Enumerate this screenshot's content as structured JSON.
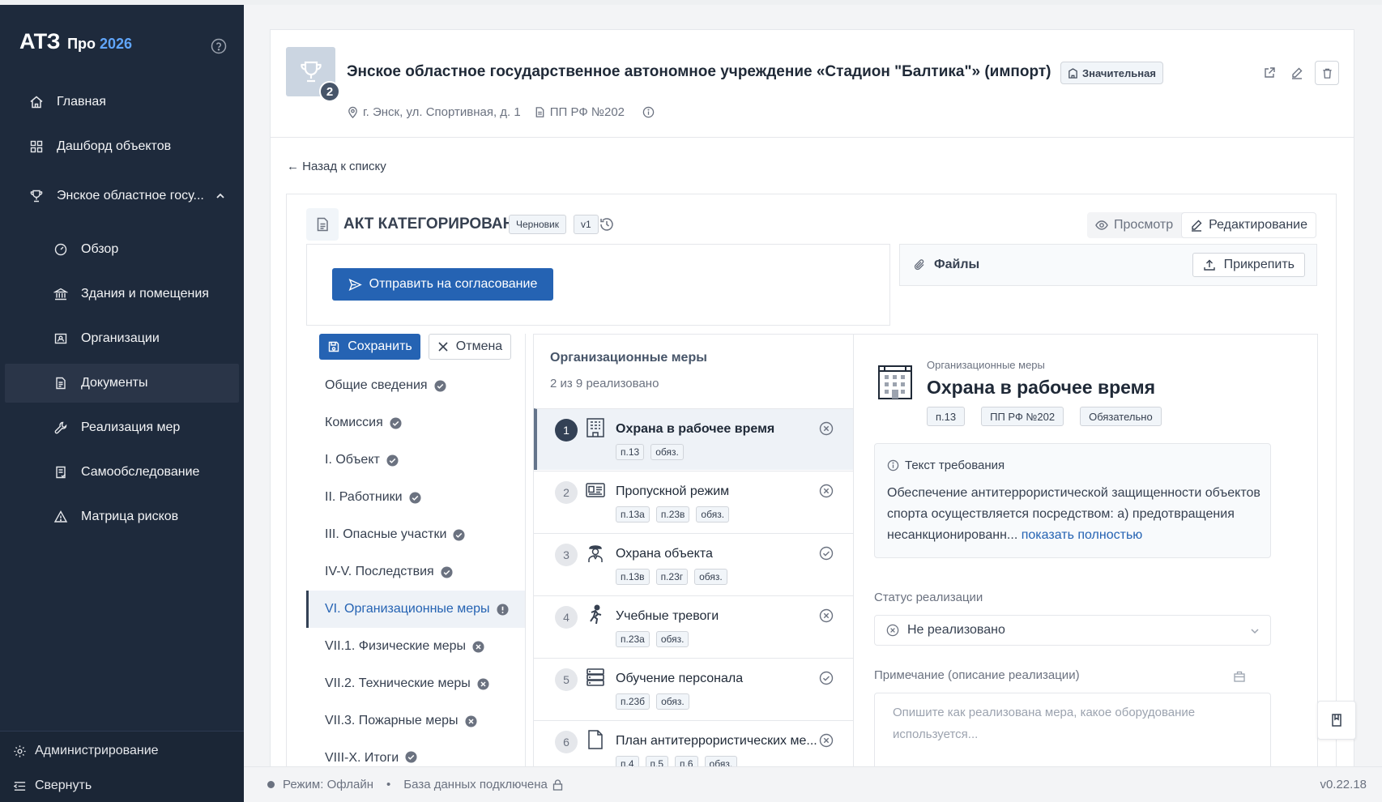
{
  "sidebar": {
    "logo": {
      "main": "АТЗ",
      "pro": "Про",
      "year": "2026"
    },
    "nav": [
      {
        "label": "Главная",
        "icon": "home-icon"
      },
      {
        "label": "Дашборд объектов",
        "icon": "grid-icon"
      },
      {
        "label": "Энское областное госу...",
        "icon": "trophy-icon"
      },
      {
        "label": "Обзор",
        "icon": "gauge-icon"
      },
      {
        "label": "Здания и помещения",
        "icon": "bank-icon"
      },
      {
        "label": "Организации",
        "icon": "id-card-icon"
      },
      {
        "label": "Документы",
        "icon": "document-icon"
      },
      {
        "label": "Реализация мер",
        "icon": "wrench-icon"
      },
      {
        "label": "Самообследование",
        "icon": "checklist-icon"
      },
      {
        "label": "Матрица рисков",
        "icon": "warning-icon"
      }
    ],
    "admin": "Администрирование",
    "collapse": "Свернуть"
  },
  "object": {
    "badge": "2",
    "title": "Энское областное государственное автономное учреждение «Стадион \"Балтика\"» (импорт)",
    "significance": "Значительная",
    "address": "г. Энск, ул. Спортивная, д. 1",
    "regulation": "ПП РФ №202"
  },
  "back": "← Назад к списку",
  "act": {
    "title": "АКТ КАТЕГОРИРОВАНИЯ",
    "status": "Черновик",
    "version": "v1",
    "mode_view": "Просмотр",
    "mode_edit": "Редактирование",
    "send": "Отправить на согласование",
    "files": "Файлы",
    "attach": "Прикрепить",
    "save": "Сохранить",
    "cancel": "Отмена"
  },
  "sections": [
    {
      "label": "Общие сведения",
      "status": "done"
    },
    {
      "label": "Комиссия",
      "status": "done"
    },
    {
      "label": "I. Объект",
      "status": "done"
    },
    {
      "label": "II. Работники",
      "status": "done"
    },
    {
      "label": "III. Опасные участки",
      "status": "done"
    },
    {
      "label": "IV-V. Последствия",
      "status": "done"
    },
    {
      "label": "VI. Организационные меры",
      "status": "warn"
    },
    {
      "label": "VII.1. Физические меры",
      "status": "error"
    },
    {
      "label": "VII.2. Технические меры",
      "status": "error"
    },
    {
      "label": "VII.3. Пожарные меры",
      "status": "error"
    },
    {
      "label": "VIII-X. Итоги",
      "status": "done"
    }
  ],
  "measures": {
    "heading": "Организационные меры",
    "progress": "2 из 9 реализовано",
    "items": [
      {
        "num": "1",
        "title": "Охрана в рабочее время",
        "tags": [
          "п.13",
          "обяз."
        ],
        "done": false,
        "icon": "building-icon"
      },
      {
        "num": "2",
        "title": "Пропускной режим",
        "tags": [
          "п.13а",
          "п.23в",
          "обяз."
        ],
        "done": false,
        "icon": "id-card-icon"
      },
      {
        "num": "3",
        "title": "Охрана объекта",
        "tags": [
          "п.13в",
          "п.23г",
          "обяз."
        ],
        "done": true,
        "icon": "guard-icon"
      },
      {
        "num": "4",
        "title": "Учебные тревоги",
        "tags": [
          "п.23а",
          "обяз."
        ],
        "done": false,
        "icon": "running-icon"
      },
      {
        "num": "5",
        "title": "Обучение персонала",
        "tags": [
          "п.23б",
          "обяз."
        ],
        "done": true,
        "icon": "books-icon"
      },
      {
        "num": "6",
        "title": "План антитеррористических ме...",
        "tags": [
          "п.4",
          "п.5",
          "п.6",
          "обяз."
        ],
        "done": false,
        "icon": "page-icon"
      }
    ]
  },
  "detail": {
    "category": "Организационные меры",
    "title": "Охрана в рабочее время",
    "tags": [
      "п.13",
      "ПП РФ №202",
      "Обязательно"
    ],
    "req_heading": "Текст требования",
    "req_text": "Обеспечение антитеррористической защищенности объектов спорта осуществляется посредством: а) предотвращения несанкционированн...",
    "req_more": "показать полностью",
    "status_label": "Статус реализации",
    "status_value": "Не реализовано",
    "note_label": "Примечание (описание реализации)",
    "note_placeholder": "Опишите как реализована мера, какое оборудование используется..."
  },
  "footer": {
    "mode": "Режим: Офлайн",
    "separator": "•",
    "db": "База данных подключена",
    "version": "v0.22.18"
  },
  "colors": {
    "sidebar": "#1e2a3c",
    "primary": "#2563b3",
    "done": "#6b7280"
  }
}
